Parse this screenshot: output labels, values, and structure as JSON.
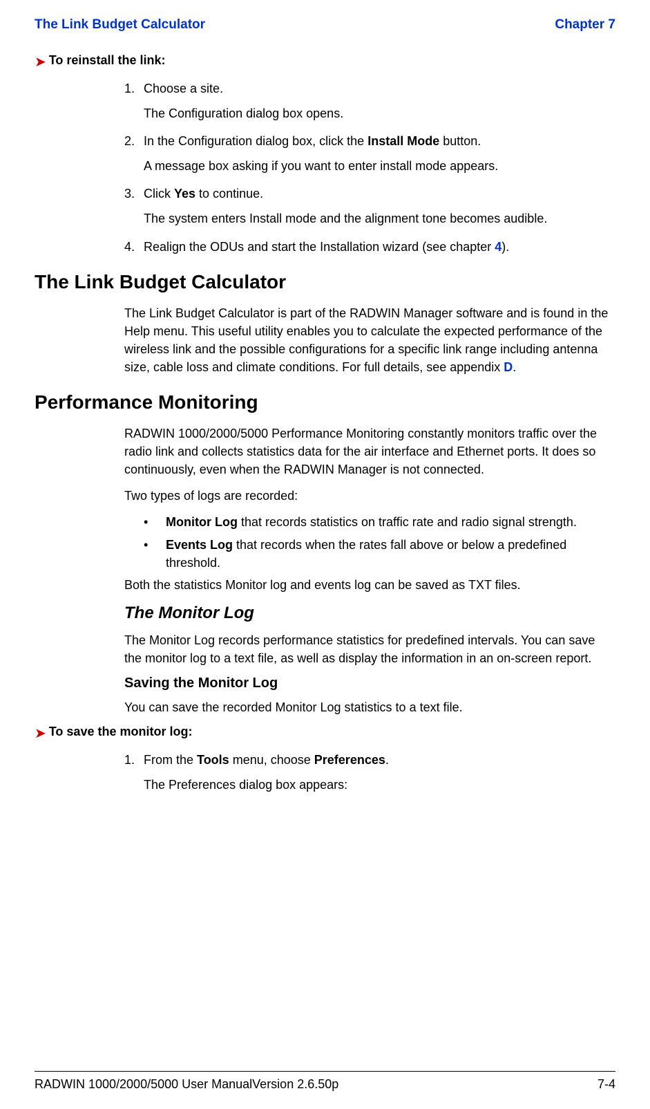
{
  "header": {
    "left": "The Link Budget Calculator",
    "right": "Chapter 7"
  },
  "proc1": {
    "title": "To reinstall the link:",
    "items": {
      "n1": "1.",
      "t1a": "Choose a site.",
      "t1b": "The Configuration dialog box opens.",
      "n2": "2.",
      "t2a_pre": "In the Configuration dialog box, click the ",
      "t2a_bold": "Install Mode",
      "t2a_post": " button.",
      "t2b": "A message box asking if you want to enter install mode appears.",
      "n3": "3.",
      "t3a_pre": "Click ",
      "t3a_bold": "Yes",
      "t3a_post": " to continue.",
      "t3b": "The system enters Install mode and the alignment tone becomes audible.",
      "n4": "4.",
      "t4a_pre": "Realign the ODUs and start the Installation wizard (see chapter ",
      "t4a_link": "4",
      "t4a_post": ")."
    }
  },
  "section_lbc": {
    "title": "The Link Budget Calculator",
    "para_pre": "The Link Budget Calculator is part of the RADWIN Manager software and is found in the Help menu. This useful utility enables you to calculate the expected performance of the wireless link and the possible configurations for a specific link range including antenna size, cable loss and climate conditions. For full details, see appendix ",
    "para_link": "D",
    "para_post": "."
  },
  "section_pm": {
    "title": "Performance Monitoring",
    "para1": "RADWIN 1000/2000/5000 Performance Monitoring constantly monitors traffic over the radio link and collects statistics data for the air interface and Ethernet ports. It does so continuously, even when the RADWIN Manager is not connected.",
    "para2": "Two types of logs are recorded:",
    "bullets": {
      "mark": "•",
      "b1_bold": "Monitor Log",
      "b1_rest": " that records statistics on traffic rate and radio signal strength.",
      "b2_bold": "Events Log",
      "b2_rest": " that records when the rates fall above or below a predefined threshold."
    },
    "para3": "Both the statistics Monitor log and events log can be saved as TXT files."
  },
  "subsection_ml": {
    "title": "The Monitor Log",
    "para": "The Monitor Log records performance statistics for predefined intervals. You can save the monitor log to a text file, as well as display the information in an on-screen report.",
    "subtitle": "Saving the Monitor Log",
    "subpara": "You can save the recorded Monitor Log statistics to a text file."
  },
  "proc2": {
    "title": "To save the monitor log:",
    "n1": "1.",
    "t1_pre": "From the ",
    "t1_b1": "Tools",
    "t1_mid": " menu, choose ",
    "t1_b2": "Preferences",
    "t1_post": ".",
    "t1b": "The Preferences dialog box appears:"
  },
  "footer": {
    "left": "RADWIN 1000/2000/5000 User ManualVersion  2.6.50p",
    "right": "7-4"
  }
}
